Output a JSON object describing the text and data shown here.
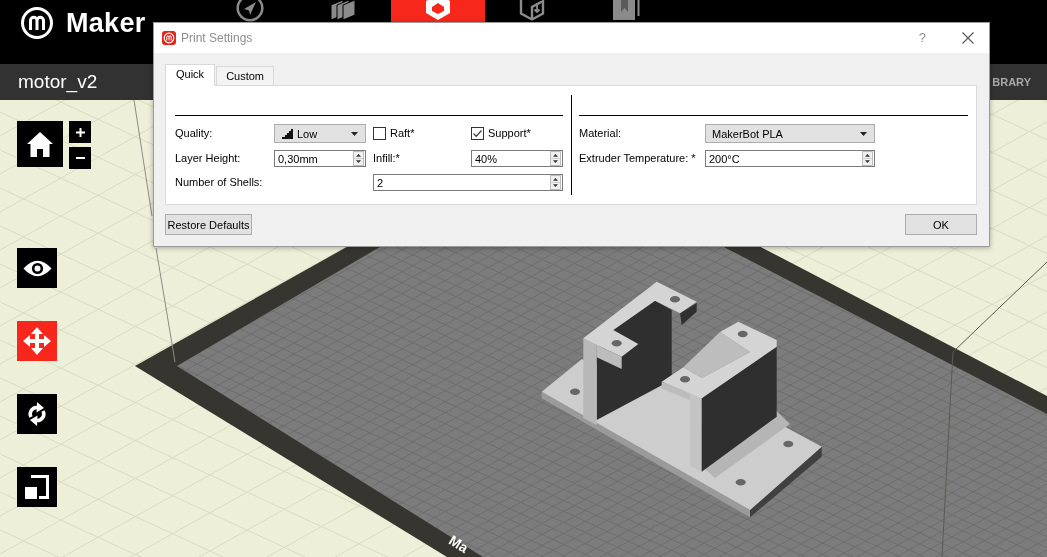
{
  "top_bar": {
    "logo_text": "Maker",
    "nav_tabs": [
      {
        "selected": false
      },
      {
        "selected": false
      },
      {
        "selected": true
      },
      {
        "selected": false
      },
      {
        "selected": false
      }
    ]
  },
  "project_bar": {
    "file_name": "motor_v2",
    "library_link": "BRARY"
  },
  "toolbar": {
    "tools": [
      {
        "selected": false
      },
      {
        "selected": true
      },
      {
        "selected": false
      },
      {
        "selected": false
      }
    ]
  },
  "build_plate": {
    "logo_text": "Ma"
  },
  "dialog": {
    "title": "Print Settings",
    "help": "?",
    "tabs": [
      {
        "label": "Quick",
        "selected": true
      },
      {
        "label": "Custom",
        "selected": false
      }
    ],
    "quality": {
      "label": "Quality:",
      "value": "Low"
    },
    "raft": {
      "label": "Raft*",
      "checked": false
    },
    "support": {
      "label": "Support*",
      "checked": true
    },
    "layer_height": {
      "label": "Layer Height:",
      "value": "0,30mm"
    },
    "infill": {
      "label": "Infill:*",
      "value": "40%"
    },
    "shells": {
      "label": "Number of Shells:",
      "value": "2"
    },
    "material": {
      "label": "Material:",
      "value": "MakerBot PLA"
    },
    "extruder_temperature": {
      "label": "Extruder Temperature: *",
      "value": "200°C"
    },
    "buttons": {
      "restore_defaults": "Restore Defaults",
      "ok": "OK"
    }
  }
}
